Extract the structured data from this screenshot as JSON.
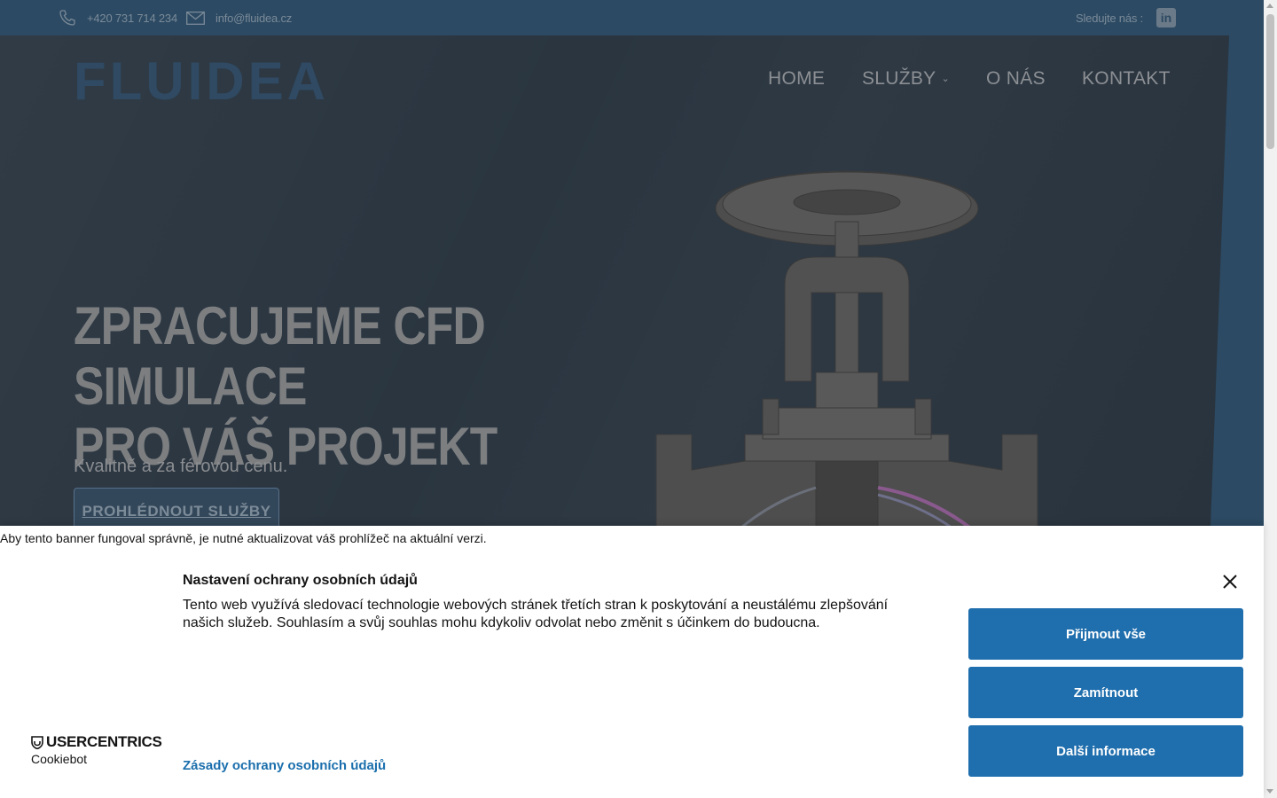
{
  "topbar": {
    "phone": "+420 731 714 234",
    "email": "info@fluidea.cz",
    "follow_label": "Sledujte nás :",
    "social": "in"
  },
  "header": {
    "logo": "FLUIDEA",
    "nav": {
      "home": "HOME",
      "services": "SLUŽBY",
      "about": "O NÁS",
      "contact": "KONTAKT"
    }
  },
  "hero": {
    "title_line1": "ZPRACUJEME CFD SIMULACE",
    "title_line2": "PRO VÁŠ PROJEKT",
    "subtitle": "Kvalitně a za férovou cenu.",
    "cta": "PROHLÉDNOUT SLUŽBY"
  },
  "cookie_banner": {
    "browser_warning": "Aby tento banner fungoval správně, je nutné aktualizovat váš prohlížeč na aktuální verzi.",
    "title": "Nastavení ochrany osobních údajů",
    "description": "Tento web využívá sledovací technologie webových stránek třetích stran k poskytování a neustálému zlepšování našich služeb. Souhlasím a svůj souhlas mohu kdykoliv odvolat nebo změnit s účinkem do budoucna.",
    "privacy_link": "Zásady ochrany osobních údajů",
    "brand_name": "USERCENTRICS",
    "brand_sub": "Cookiebot",
    "accept_all": "Přijmout vše",
    "reject": "Zamítnout",
    "more_info": "Další informace"
  },
  "colors": {
    "topbar_bg": "#2c4a63",
    "hero_bg": "#2a3540",
    "accent_button": "#1f6ead",
    "link": "#1b6fad"
  }
}
